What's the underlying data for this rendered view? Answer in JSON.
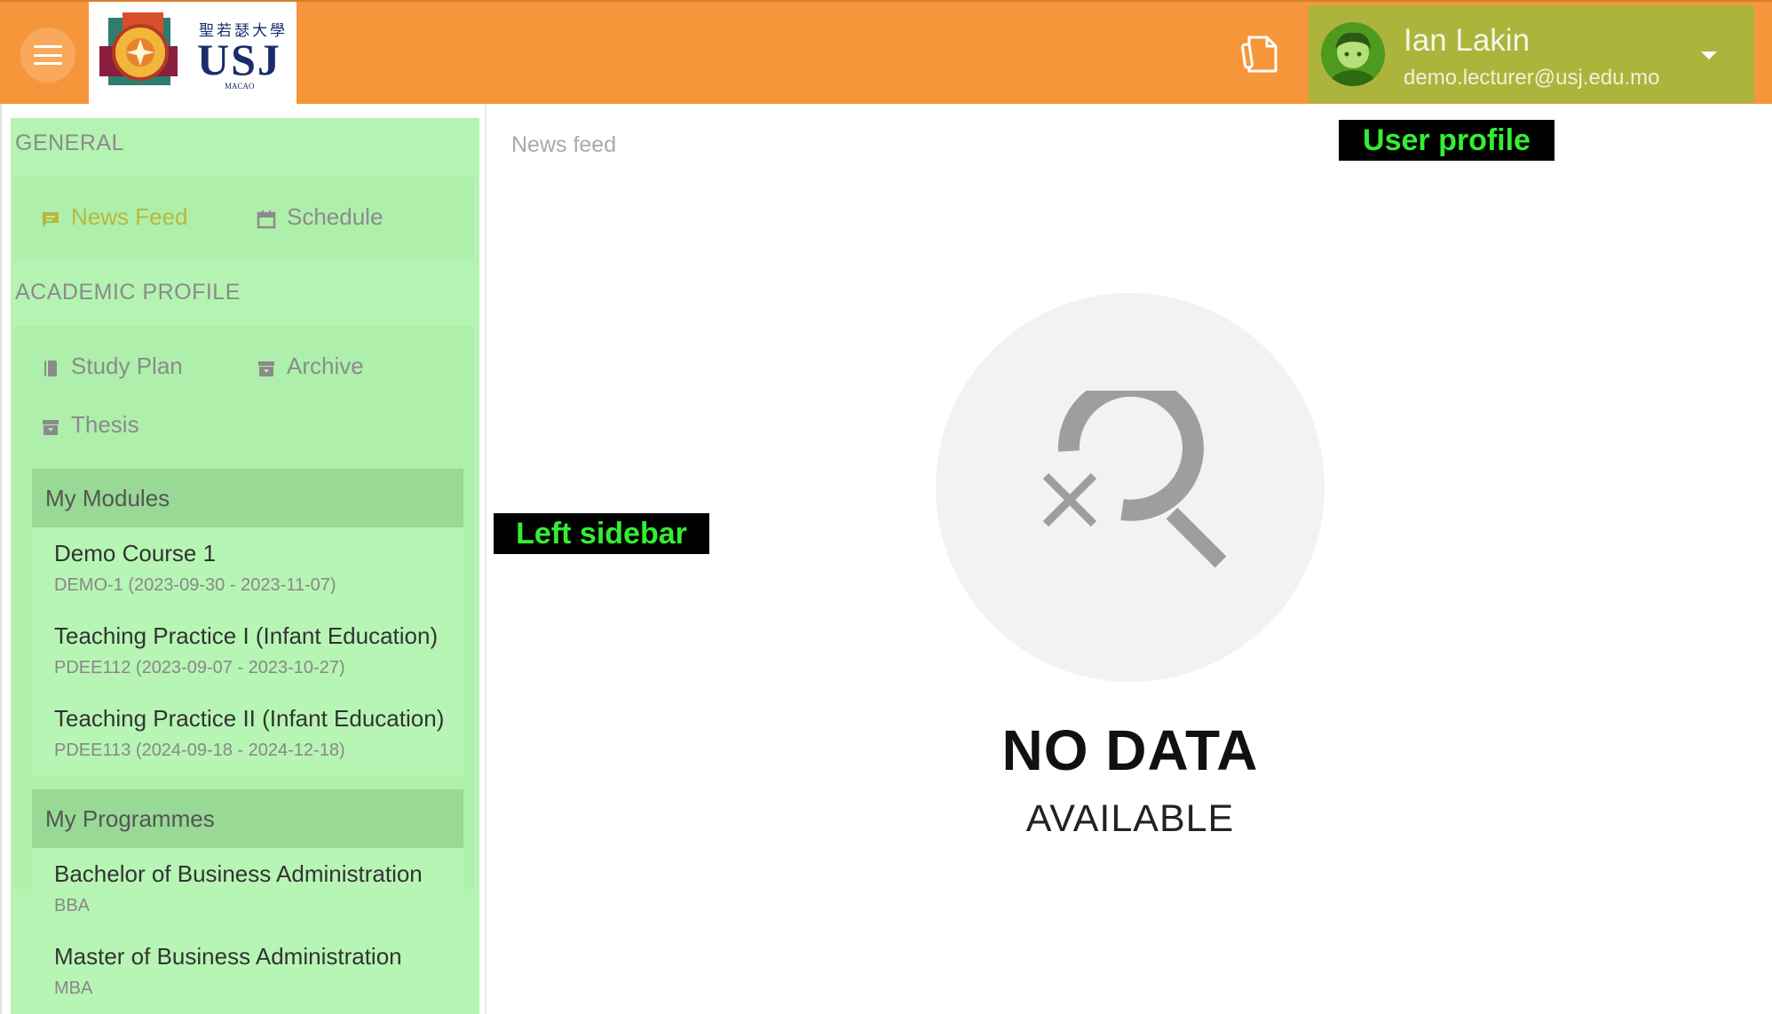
{
  "header": {
    "menu_icon": "hamburger-icon",
    "logo": {
      "cjk_text": "聖若瑟大學",
      "text": "USJ",
      "subtext": "MACAO"
    },
    "document_icon": "document-pen-icon",
    "user": {
      "name": "Ian Lakin",
      "email": "demo.lecturer@usj.edu.mo",
      "avatar_icon": "user-avatar-icon",
      "dropdown_icon": "caret-down-icon"
    },
    "colors": {
      "bar": "#f6963a",
      "profile": "#acb43c"
    }
  },
  "sidebar": {
    "general_title": "GENERAL",
    "general_items": [
      {
        "label": "News Feed",
        "icon": "message-icon",
        "active": true
      },
      {
        "label": "Schedule",
        "icon": "calendar-icon",
        "active": false
      }
    ],
    "academic_title": "ACADEMIC PROFILE",
    "academic_items": [
      {
        "label": "Study Plan",
        "icon": "book-icon"
      },
      {
        "label": "Archive",
        "icon": "archive-icon"
      },
      {
        "label": "Thesis",
        "icon": "thesis-icon"
      }
    ],
    "modules": {
      "title": "My Modules",
      "items": [
        {
          "title": "Demo Course 1",
          "sub": "DEMO-1 (2023-09-30 - 2023-11-07)"
        },
        {
          "title": "Teaching Practice I (Infant Education)",
          "sub": "PDEE112 (2023-09-07 - 2023-10-27)"
        },
        {
          "title": "Teaching Practice II (Infant Education)",
          "sub": "PDEE113 (2024-09-18 - 2024-12-18)"
        }
      ]
    },
    "programmes": {
      "title": "My Programmes",
      "items": [
        {
          "title": "Bachelor of Business Administration",
          "sub": "BBA"
        },
        {
          "title": "Master of Business Administration",
          "sub": "MBA"
        }
      ]
    }
  },
  "main": {
    "title": "News feed",
    "empty_icon": "search-no-results-icon",
    "empty_title": "NO DATA",
    "empty_subtitle": "AVAILABLE"
  },
  "annotations": {
    "user_profile": "User profile",
    "left_sidebar": "Left sidebar"
  }
}
